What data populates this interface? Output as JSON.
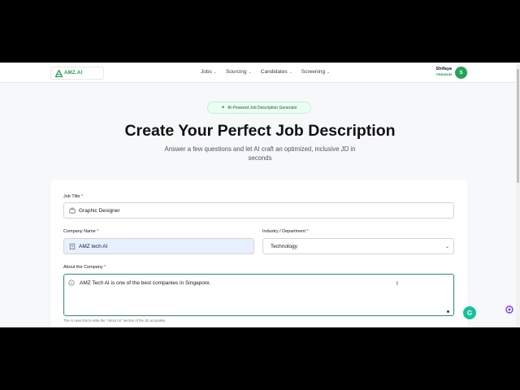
{
  "header": {
    "logo_text": "AMZ.AI",
    "nav": [
      {
        "label": "Jobs"
      },
      {
        "label": "Sourcing"
      },
      {
        "label": "Candidates"
      },
      {
        "label": "Screening"
      }
    ],
    "user_name": "Shifaya",
    "user_tier": "PREMIUM",
    "avatar_initial": "S"
  },
  "hero": {
    "badge": "AI-Powered Job Description Generator",
    "title": "Create Your Perfect Job Description",
    "subtitle": "Answer a few questions and let AI craft an optimized, inclusive JD in seconds"
  },
  "form": {
    "job_title_label": "Job Title",
    "job_title_value": "Graphic Designer",
    "company_label": "Company Name",
    "company_value": "AMZ tech AI",
    "industry_label": "Industry / Department",
    "industry_value": "Technology",
    "about_label": "About the Company",
    "about_value": "AMZ Tech AI is one of the best companies in Singapore.",
    "about_hint": "The AI uses this to write the \"About Us\" section of the JD accurately",
    "required_mark": "*"
  },
  "overlays": {
    "grammarly_letter": "G"
  },
  "colors": {
    "accent": "#22a559",
    "badge_bg": "#ecfdf3",
    "autofill_bg": "#e8f0fe",
    "required": "#dc2626"
  }
}
